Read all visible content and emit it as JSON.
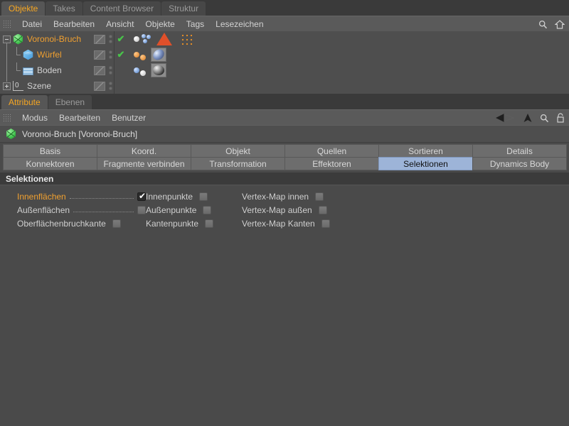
{
  "object_manager": {
    "tabs": [
      {
        "label": "Objekte",
        "active": true
      },
      {
        "label": "Takes",
        "active": false
      },
      {
        "label": "Content Browser",
        "active": false
      },
      {
        "label": "Struktur",
        "active": false
      }
    ],
    "menu": [
      "Datei",
      "Bearbeiten",
      "Ansicht",
      "Objekte",
      "Tags",
      "Lesezeichen"
    ],
    "toolbar_icons": [
      "search-icon",
      "home-icon"
    ],
    "rows": [
      {
        "name": "Voronoi-Bruch",
        "icon": "fracture-icon",
        "selected": true,
        "depth": 0,
        "expander": "minus",
        "visible_check": true
      },
      {
        "name": "Würfel",
        "icon": "cube-icon",
        "selected": true,
        "depth": 1,
        "expander": "none",
        "visible_check": true
      },
      {
        "name": "Boden",
        "icon": "floor-icon",
        "selected": false,
        "depth": 0,
        "expander": "none",
        "visible_check": false
      },
      {
        "name": "Szene",
        "icon": "scene-icon",
        "selected": false,
        "depth": 0,
        "expander": "plus",
        "visible_check": false
      }
    ]
  },
  "attribute_manager": {
    "tabs": [
      {
        "label": "Attribute",
        "active": true
      },
      {
        "label": "Ebenen",
        "active": false
      }
    ],
    "menu": [
      "Modus",
      "Bearbeiten",
      "Benutzer"
    ],
    "toolbar_icons": [
      "back-arrow-icon",
      "forward-arrow-icon",
      "search-icon",
      "lock-icon"
    ],
    "object_title": "Voronoi-Bruch [Voronoi-Bruch]",
    "object_icon": "fracture-icon",
    "tab_buttons": [
      {
        "label": "Basis",
        "active": false
      },
      {
        "label": "Koord.",
        "active": false
      },
      {
        "label": "Objekt",
        "active": false
      },
      {
        "label": "Quellen",
        "active": false
      },
      {
        "label": "Sortieren",
        "active": false
      },
      {
        "label": "Details",
        "active": false
      },
      {
        "label": "Konnektoren",
        "active": false
      },
      {
        "label": "Fragmente verbinden",
        "active": false
      },
      {
        "label": "Transformation",
        "active": false
      },
      {
        "label": "Effektoren",
        "active": false
      },
      {
        "label": "Selektionen",
        "active": true
      },
      {
        "label": "Dynamics Body",
        "active": false
      }
    ],
    "group_header": "Selektionen",
    "checkbox_rows": [
      [
        {
          "label": "Innenflächen",
          "checked": true,
          "highlight": true,
          "leader": true
        },
        {
          "label": "Innenpunkte",
          "checked": false,
          "highlight": false,
          "leader": false
        },
        {
          "label": "Vertex-Map innen",
          "checked": false,
          "highlight": false,
          "leader": false
        }
      ],
      [
        {
          "label": "Außenflächen",
          "checked": false,
          "highlight": false,
          "leader": true
        },
        {
          "label": "Außenpunkte",
          "checked": false,
          "highlight": false,
          "leader": false
        },
        {
          "label": "Vertex-Map außen",
          "checked": false,
          "highlight": false,
          "leader": false
        }
      ],
      [
        {
          "label": "Oberflächenbruchkante",
          "checked": false,
          "highlight": false,
          "leader": false
        },
        {
          "label": "Kantenpunkte",
          "checked": false,
          "highlight": false,
          "leader": false
        },
        {
          "label": "Vertex-Map Kanten",
          "checked": false,
          "highlight": false,
          "leader": false
        }
      ]
    ]
  },
  "colors": {
    "accent_orange": "#f0a030",
    "active_tab_blue": "#9db4d8",
    "panel_bg": "#4a4a4a",
    "check_green": "#49c34a"
  }
}
